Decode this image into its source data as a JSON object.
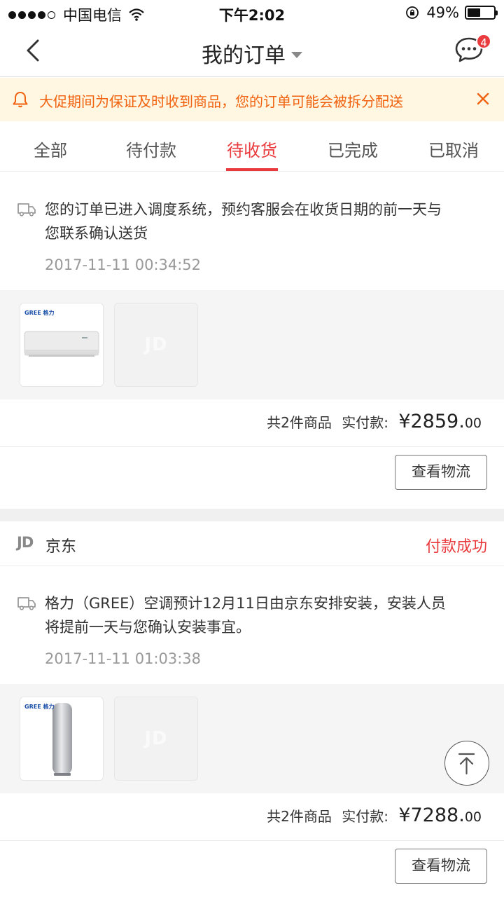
{
  "status_bar": {
    "carrier": "中国电信",
    "time": "下午2:02",
    "battery": "49%",
    "battery_level": 0.49
  },
  "nav": {
    "title": "我的订单",
    "message_count": "4"
  },
  "notice": {
    "text": "大促期间为保证及时收到商品，您的订单可能会被拆分配送"
  },
  "tabs": [
    {
      "label": "全部",
      "active": false
    },
    {
      "label": "待付款",
      "active": false
    },
    {
      "label": "待收货",
      "active": true
    },
    {
      "label": "已完成",
      "active": false
    },
    {
      "label": "已取消",
      "active": false
    }
  ],
  "orders": [
    {
      "logistics_line1": "您的订单已进入调度系统，预约客服会在收货日期的前一天与",
      "logistics_line2": "您联系确认送货",
      "logistics_time": "2017-11-11 00:34:52",
      "product_brand": "GREE 格力",
      "count_text": "共2件商品",
      "paid_label": "实付款:",
      "price_int": "¥2859.",
      "price_dec": "00",
      "button": "查看物流"
    },
    {
      "shop_logo": "JD",
      "shop_name": "京东",
      "status": "付款成功",
      "logistics_line1": "格力（GREE）空调预计12月11日由京东安排安装，安装人员",
      "logistics_line2": "将提前一天与您确认安装事宜。",
      "logistics_time": "2017-11-11 01:03:38",
      "product_brand": "GREE 格力",
      "count_text": "共2件商品",
      "paid_label": "实付款:",
      "price_int": "¥7288.",
      "price_dec": "00",
      "button": "查看物流"
    }
  ],
  "watermark": "JD",
  "colors": {
    "accent": "#e93b3d",
    "notice_text": "#f0620f",
    "notice_bg": "#fff7e1"
  }
}
